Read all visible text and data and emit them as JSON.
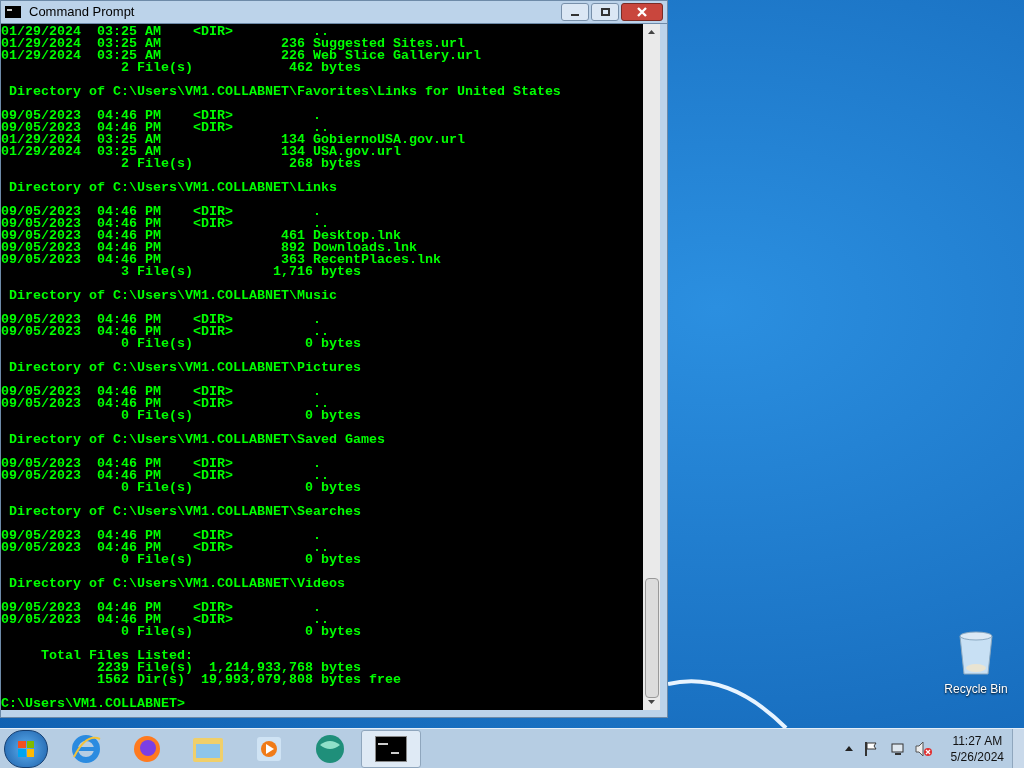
{
  "window": {
    "title": "Command Prompt"
  },
  "console": {
    "blocks": [
      {
        "entries": [
          "01/29/2024  03:25 AM    <DIR>          ..",
          "01/29/2024  03:25 AM               236 Suggested Sites.url",
          "01/29/2024  03:25 AM               226 Web Slice Gallery.url"
        ],
        "summary": "               2 File(s)            462 bytes"
      },
      {
        "header": " Directory of C:\\Users\\VM1.COLLABNET\\Favorites\\Links for United States",
        "entries": [
          "09/05/2023  04:46 PM    <DIR>          .",
          "09/05/2023  04:46 PM    <DIR>          ..",
          "01/29/2024  03:25 AM               134 GobiernoUSA.gov.url",
          "01/29/2024  03:25 AM               134 USA.gov.url"
        ],
        "summary": "               2 File(s)            268 bytes"
      },
      {
        "header": " Directory of C:\\Users\\VM1.COLLABNET\\Links",
        "entries": [
          "09/05/2023  04:46 PM    <DIR>          .",
          "09/05/2023  04:46 PM    <DIR>          ..",
          "09/05/2023  04:46 PM               461 Desktop.lnk",
          "09/05/2023  04:46 PM               892 Downloads.lnk",
          "09/05/2023  04:46 PM               363 RecentPlaces.lnk"
        ],
        "summary": "               3 File(s)          1,716 bytes"
      },
      {
        "header": " Directory of C:\\Users\\VM1.COLLABNET\\Music",
        "entries": [
          "09/05/2023  04:46 PM    <DIR>          .",
          "09/05/2023  04:46 PM    <DIR>          .."
        ],
        "summary": "               0 File(s)              0 bytes"
      },
      {
        "header": " Directory of C:\\Users\\VM1.COLLABNET\\Pictures",
        "entries": [
          "09/05/2023  04:46 PM    <DIR>          .",
          "09/05/2023  04:46 PM    <DIR>          .."
        ],
        "summary": "               0 File(s)              0 bytes"
      },
      {
        "header": " Directory of C:\\Users\\VM1.COLLABNET\\Saved Games",
        "entries": [
          "09/05/2023  04:46 PM    <DIR>          .",
          "09/05/2023  04:46 PM    <DIR>          .."
        ],
        "summary": "               0 File(s)              0 bytes"
      },
      {
        "header": " Directory of C:\\Users\\VM1.COLLABNET\\Searches",
        "entries": [
          "09/05/2023  04:46 PM    <DIR>          .",
          "09/05/2023  04:46 PM    <DIR>          .."
        ],
        "summary": "               0 File(s)              0 bytes"
      },
      {
        "header": " Directory of C:\\Users\\VM1.COLLABNET\\Videos",
        "entries": [
          "09/05/2023  04:46 PM    <DIR>          .",
          "09/05/2023  04:46 PM    <DIR>          .."
        ],
        "summary": "               0 File(s)              0 bytes"
      }
    ],
    "total": {
      "label": "     Total Files Listed:",
      "lines": [
        "            2239 File(s)  1,214,933,768 bytes",
        "            1562 Dir(s)  19,993,079,808 bytes free"
      ]
    },
    "prompt": "C:\\Users\\VM1.COLLABNET>"
  },
  "desktop": {
    "icons": [
      {
        "label": "Recycle Bin"
      }
    ]
  },
  "taskbar": {
    "apps": [
      {
        "kind": "ie",
        "selected": false
      },
      {
        "kind": "firefox",
        "selected": false
      },
      {
        "kind": "explorer",
        "selected": false
      },
      {
        "kind": "media",
        "selected": false
      },
      {
        "kind": "globe",
        "selected": false
      },
      {
        "kind": "cmd",
        "selected": true
      }
    ],
    "clock": {
      "time": "11:27 AM",
      "date": "5/26/2024"
    }
  }
}
